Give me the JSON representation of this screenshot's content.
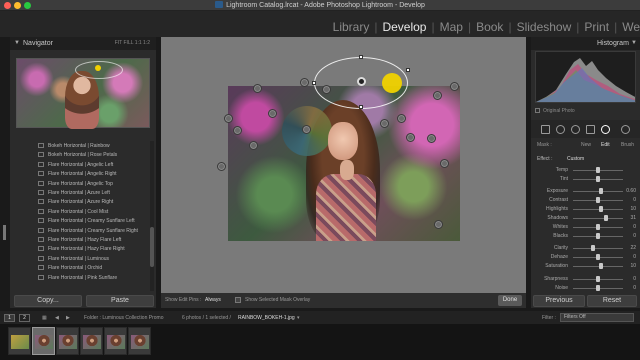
{
  "window": {
    "title": "Lightroom Catalog.lrcat - Adobe Photoshop Lightroom - Develop",
    "traffic_colors": [
      "#ff5f57",
      "#febc2e",
      "#28c840"
    ]
  },
  "modules": {
    "items": [
      "Library",
      "Develop",
      "Map",
      "Book",
      "Slideshow",
      "Print",
      "We"
    ],
    "active": "Develop",
    "separator": "|"
  },
  "navigator": {
    "title": "Navigator",
    "zoom_options": "FIT  FILL  1:1  1:2"
  },
  "presets": [
    "Bokeh Horizontal | Rainbow",
    "Bokeh Horizontal | Rose Petals",
    "Flare Horizontal | Angelic Left",
    "Flare Horizontal | Angelic Right",
    "Flare Horizontal | Angelic Top",
    "Flare Horizontal | Azure Left",
    "Flare Horizontal | Azure Right",
    "Flare Horizontal | Cool Mist",
    "Flare Horizontal | Creamy Sunflare Left",
    "Flare Horizontal | Creamy Sunflare Right",
    "Flare Horizontal | Hazy Flare Left",
    "Flare Horizontal | Hazy Flare Right",
    "Flare Horizontal | Luminous",
    "Flare Horizontal | Orchid",
    "Flare Horizontal | Pink Sunflare"
  ],
  "left_buttons": {
    "copy": "Copy...",
    "paste": "Paste"
  },
  "toolbar": {
    "show_edit_pins_label": "Show Edit Pins :",
    "show_edit_pins_value": "Always",
    "show_mask_overlay": "Show Selected Mask Overlay",
    "done": "Done"
  },
  "right_panel": {
    "histogram_title": "Histogram",
    "original_photo": "Original Photo",
    "mask_tabs": {
      "mask": "Mask :",
      "new": "New",
      "edit": "Edit",
      "brush": "Brush"
    },
    "effect_label": "Effect :",
    "effect_value": "Custom",
    "adjustments": [
      {
        "label": "Temp",
        "value": "",
        "pos": 0.5
      },
      {
        "label": "Tint",
        "value": "",
        "pos": 0.5
      },
      {
        "label": "Exposure",
        "value": "0.60",
        "pos": 0.56
      },
      {
        "label": "Contrast",
        "value": "0",
        "pos": 0.5
      },
      {
        "label": "Highlights",
        "value": "10",
        "pos": 0.55
      },
      {
        "label": "Shadows",
        "value": "31",
        "pos": 0.65
      },
      {
        "label": "Whites",
        "value": "0",
        "pos": 0.5
      },
      {
        "label": "Blacks",
        "value": "0",
        "pos": 0.5
      },
      {
        "label": "Clarity",
        "value": "22",
        "pos": 0.39
      },
      {
        "label": "Dehaze",
        "value": "0",
        "pos": 0.5
      },
      {
        "label": "Saturation",
        "value": "10",
        "pos": 0.55
      },
      {
        "label": "Sharpness",
        "value": "0",
        "pos": 0.5
      },
      {
        "label": "Noise",
        "value": "0",
        "pos": 0.5
      }
    ],
    "previous": "Previous",
    "reset": "Reset"
  },
  "filmbar": {
    "page1": "1",
    "page2": "2",
    "folder": "Folder : Luminous Collection Promo",
    "count": "6 photos / 1 selected /",
    "filename": "RAINBOW_BOKEH-1.jpg",
    "filter_label": "Filter :",
    "filter_value": "Filters Off"
  }
}
